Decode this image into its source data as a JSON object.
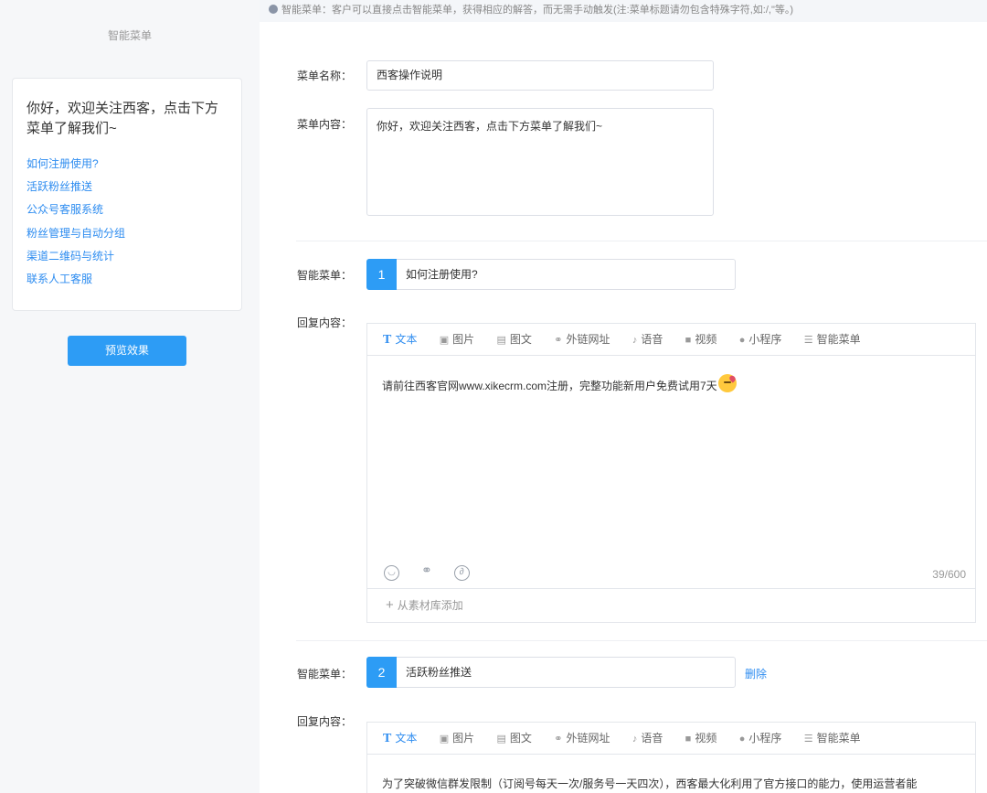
{
  "preview": {
    "title": "智能菜单",
    "greeting": "你好，欢迎关注西客，点击下方菜单了解我们~",
    "menu_items": [
      "如何注册使用?",
      "活跃粉丝推送",
      "公众号客服系统",
      "粉丝管理与自动分组",
      "渠道二维码与统计",
      "联系人工客服"
    ],
    "preview_button": "预览效果"
  },
  "tip": "智能菜单：客户可以直接点击智能菜单，获得相应的解答，而无需手动触发(注:菜单标题请勿包含特殊字符,如:/,\"等。)",
  "form": {
    "name_label": "菜单名称：",
    "name_value": "西客操作说明",
    "content_label": "菜单内容：",
    "content_value": "你好，欢迎关注西客，点击下方菜单了解我们~"
  },
  "menus": [
    {
      "label": "智能菜单：",
      "number": "1",
      "title": "如何注册使用?",
      "reply_label": "回复内容：",
      "reply_text": "请前往西客官网www.xikecrm.com注册，完整功能新用户免费试用7天",
      "count": "39/600",
      "footer": "从素材库添加"
    },
    {
      "label": "智能菜单：",
      "number": "2",
      "title": "活跃粉丝推送",
      "delete": "删除",
      "reply_label": "回复内容：",
      "reply_text": "为了突破微信群发限制（订阅号每天一次/服务号一天四次），西客最大化利用了官方接口的能力，使用运营者能"
    }
  ],
  "tabs": [
    "文本",
    "图片",
    "图文",
    "外链网址",
    "语音",
    "视频",
    "小程序",
    "智能菜单"
  ],
  "tab_icons": [
    "text-icon",
    "image-icon",
    "article-icon",
    "link-icon",
    "voice-icon",
    "video-icon",
    "miniprogram-icon",
    "menu-icon"
  ]
}
